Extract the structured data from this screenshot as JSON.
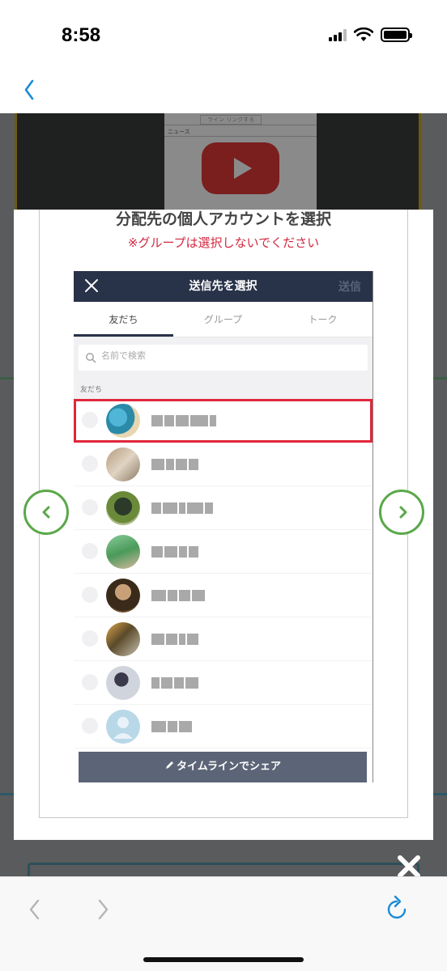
{
  "status_bar": {
    "time": "8:58",
    "battery_level": 1.0
  },
  "background_page": {
    "thumb_mini_label": "ライン リンクする",
    "thumb_news_label": "ニュース"
  },
  "modal": {
    "title": "分配先の個人アカウントを選択",
    "note": "※グループは選択しないでください"
  },
  "line_screen": {
    "header_title": "送信先を選択",
    "send_label": "送信",
    "tabs": [
      {
        "label": "友だち",
        "active": true
      },
      {
        "label": "グループ",
        "active": false
      },
      {
        "label": "トーク",
        "active": false
      }
    ],
    "search_placeholder": "名前で検索",
    "section_label": "友だち",
    "share_button": "タイムラインでシェア",
    "friends_count": 8
  },
  "colors": {
    "line_header": "#283249",
    "highlight": "#e0273a",
    "note_red": "#d2273f",
    "arrow_green": "#5aa84a",
    "ios_blue": "#1a8bd8"
  },
  "icons": [
    "back-chevron-icon",
    "close-icon",
    "search-icon",
    "arrow-left-icon",
    "arrow-right-icon",
    "pencil-icon",
    "reload-icon"
  ]
}
